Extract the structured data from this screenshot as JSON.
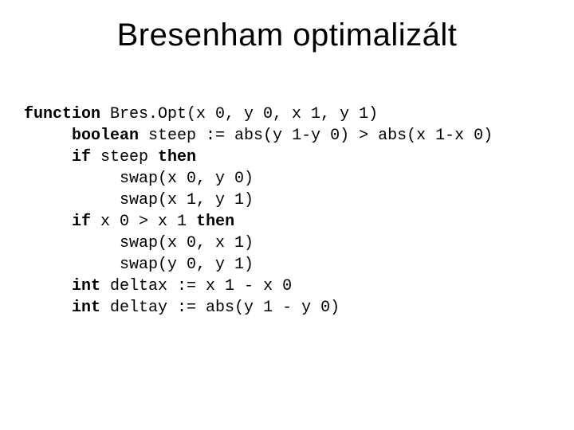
{
  "title": "Bresenham optimalizált",
  "code": {
    "kw_function": "function",
    "sig": " Bres.Opt(x 0, y 0, x 1, y 1)",
    "kw_boolean": "boolean",
    "steep_rhs": " steep := abs(y 1-y 0) > abs(x 1-x 0)",
    "kw_if1": "if",
    "if1_mid": " steep ",
    "kw_then1": "then",
    "swap1": "swap(x 0, y 0)",
    "swap2": "swap(x 1, y 1)",
    "kw_if2": "if",
    "if2_mid": " x 0 > x 1 ",
    "kw_then2": "then",
    "swap3": "swap(x 0, x 1)",
    "swap4": "swap(y 0, y 1)",
    "kw_int1": "int",
    "deltax": " deltax := x 1 - x 0",
    "kw_int2": "int",
    "deltay": " deltay := abs(y 1 - y 0)"
  }
}
